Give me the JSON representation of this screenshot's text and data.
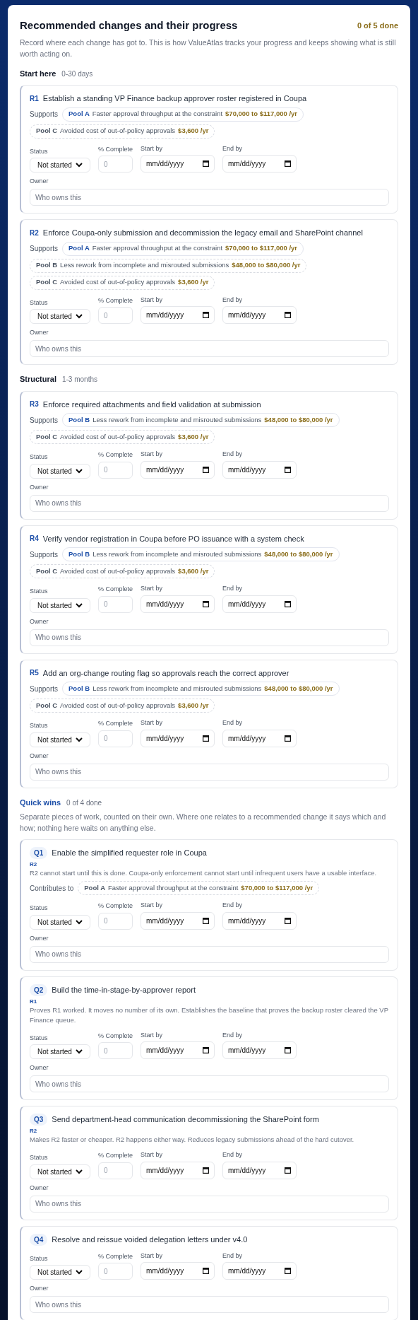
{
  "header": {
    "title": "Recommended changes and their progress",
    "progress": "0 of 5 done"
  },
  "intro": "Record where each change has got to. This is how ValueAtlas tracks your progress and keeps showing what is still worth acting on.",
  "sections": [
    {
      "kind": "plain",
      "title": "Start here",
      "subtitle": "0-30 days",
      "items": [
        {
          "code": "R1",
          "title": "Establish a standing VP Finance backup approver roster registered in Coupa",
          "pools_label": "Supports",
          "pools": [
            {
              "name": "Pool A",
              "desc": "Faster approval throughput at the constraint",
              "amount": "$70,000 to $117,000 /yr",
              "primary": true
            },
            {
              "name": "Pool C",
              "desc": "Avoided cost of out-of-policy approvals",
              "amount": "$3,600 /yr",
              "primary": false
            }
          ],
          "fields": {
            "status_label": "Status",
            "status": "Not started",
            "percent_label": "% Complete",
            "percent_placeholder": "0",
            "start_label": "Start by",
            "start_placeholder": "mm/dd/yyyy",
            "end_label": "End by",
            "end_placeholder": "mm/dd/yyyy",
            "owner_label": "Owner",
            "owner_placeholder": "Who owns this"
          }
        },
        {
          "code": "R2",
          "title": "Enforce Coupa-only submission and decommission the legacy email and SharePoint channel",
          "pools_label": "Supports",
          "pools": [
            {
              "name": "Pool A",
              "desc": "Faster approval throughput at the constraint",
              "amount": "$70,000 to $117,000 /yr",
              "primary": true
            },
            {
              "name": "Pool B",
              "desc": "Less rework from incomplete and misrouted submissions",
              "amount": "$48,000 to $80,000 /yr",
              "primary": false
            },
            {
              "name": "Pool C",
              "desc": "Avoided cost of out-of-policy approvals",
              "amount": "$3,600 /yr",
              "primary": false
            }
          ],
          "fields": {
            "status_label": "Status",
            "status": "Not started",
            "percent_label": "% Complete",
            "percent_placeholder": "0",
            "start_label": "Start by",
            "start_placeholder": "mm/dd/yyyy",
            "end_label": "End by",
            "end_placeholder": "mm/dd/yyyy",
            "owner_label": "Owner",
            "owner_placeholder": "Who owns this"
          }
        }
      ]
    },
    {
      "kind": "plain",
      "title": "Structural",
      "subtitle": "1-3 months",
      "items": [
        {
          "code": "R3",
          "title": "Enforce required attachments and field validation at submission",
          "pools_label": "Supports",
          "pools": [
            {
              "name": "Pool B",
              "desc": "Less rework from incomplete and misrouted submissions",
              "amount": "$48,000 to $80,000 /yr",
              "primary": true
            },
            {
              "name": "Pool C",
              "desc": "Avoided cost of out-of-policy approvals",
              "amount": "$3,600 /yr",
              "primary": false
            }
          ],
          "fields": {
            "status_label": "Status",
            "status": "Not started",
            "percent_label": "% Complete",
            "percent_placeholder": "0",
            "start_label": "Start by",
            "start_placeholder": "mm/dd/yyyy",
            "end_label": "End by",
            "end_placeholder": "mm/dd/yyyy",
            "owner_label": "Owner",
            "owner_placeholder": "Who owns this"
          }
        },
        {
          "code": "R4",
          "title": "Verify vendor registration in Coupa before PO issuance with a system check",
          "pools_label": "Supports",
          "pools": [
            {
              "name": "Pool B",
              "desc": "Less rework from incomplete and misrouted submissions",
              "amount": "$48,000 to $80,000 /yr",
              "primary": true
            },
            {
              "name": "Pool C",
              "desc": "Avoided cost of out-of-policy approvals",
              "amount": "$3,600 /yr",
              "primary": false
            }
          ],
          "fields": {
            "status_label": "Status",
            "status": "Not started",
            "percent_label": "% Complete",
            "percent_placeholder": "0",
            "start_label": "Start by",
            "start_placeholder": "mm/dd/yyyy",
            "end_label": "End by",
            "end_placeholder": "mm/dd/yyyy",
            "owner_label": "Owner",
            "owner_placeholder": "Who owns this"
          }
        },
        {
          "code": "R5",
          "title": "Add an org-change routing flag so approvals reach the correct approver",
          "pools_label": "Supports",
          "pools": [
            {
              "name": "Pool B",
              "desc": "Less rework from incomplete and misrouted submissions",
              "amount": "$48,000 to $80,000 /yr",
              "primary": true
            },
            {
              "name": "Pool C",
              "desc": "Avoided cost of out-of-policy approvals",
              "amount": "$3,600 /yr",
              "primary": false
            }
          ],
          "fields": {
            "status_label": "Status",
            "status": "Not started",
            "percent_label": "% Complete",
            "percent_placeholder": "0",
            "start_label": "Start by",
            "start_placeholder": "mm/dd/yyyy",
            "end_label": "End by",
            "end_placeholder": "mm/dd/yyyy",
            "owner_label": "Owner",
            "owner_placeholder": "Who owns this"
          }
        }
      ]
    },
    {
      "kind": "quick",
      "title": "Quick wins",
      "subtitle": "0 of 4 done",
      "description": "Separate pieces of work, counted on their own. Where one relates to a recommended change it says which and how; nothing here waits on anything else.",
      "items": [
        {
          "code": "Q1",
          "title": "Enable the simplified requester role in Coupa",
          "ref": "R2",
          "note": "R2 cannot start until this is done. Coupa-only enforcement cannot start until infrequent users have a usable interface.",
          "pools_label": "Contributes to",
          "pools": [
            {
              "name": "Pool A",
              "desc": "Faster approval throughput at the constraint",
              "amount": "$70,000 to $117,000 /yr",
              "primary": false
            }
          ],
          "fields": {
            "status_label": "Status",
            "status": "Not started",
            "percent_label": "% Complete",
            "percent_placeholder": "0",
            "start_label": "Start by",
            "start_placeholder": "mm/dd/yyyy",
            "end_label": "End by",
            "end_placeholder": "mm/dd/yyyy",
            "owner_label": "Owner",
            "owner_placeholder": "Who owns this"
          }
        },
        {
          "code": "Q2",
          "title": "Build the time-in-stage-by-approver report",
          "ref": "R1",
          "note": "Proves R1 worked. It moves no number of its own. Establishes the baseline that proves the backup roster cleared the VP Finance queue.",
          "fields": {
            "status_label": "Status",
            "status": "Not started",
            "percent_label": "% Complete",
            "percent_placeholder": "0",
            "start_label": "Start by",
            "start_placeholder": "mm/dd/yyyy",
            "end_label": "End by",
            "end_placeholder": "mm/dd/yyyy",
            "owner_label": "Owner",
            "owner_placeholder": "Who owns this"
          }
        },
        {
          "code": "Q3",
          "title": "Send department-head communication decommissioning the SharePoint form",
          "ref": "R2",
          "note": "Makes R2 faster or cheaper. R2 happens either way. Reduces legacy submissions ahead of the hard cutover.",
          "fields": {
            "status_label": "Status",
            "status": "Not started",
            "percent_label": "% Complete",
            "percent_placeholder": "0",
            "start_label": "Start by",
            "start_placeholder": "mm/dd/yyyy",
            "end_label": "End by",
            "end_placeholder": "mm/dd/yyyy",
            "owner_label": "Owner",
            "owner_placeholder": "Who owns this"
          }
        },
        {
          "code": "Q4",
          "title": "Resolve and reissue voided delegation letters under v4.0",
          "fields": {
            "status_label": "Status",
            "status": "Not started",
            "percent_label": "% Complete",
            "percent_placeholder": "0",
            "start_label": "Start by",
            "start_placeholder": "mm/dd/yyyy",
            "end_label": "End by",
            "end_placeholder": "mm/dd/yyyy",
            "owner_label": "Owner",
            "owner_placeholder": "Who owns this"
          }
        }
      ]
    }
  ]
}
